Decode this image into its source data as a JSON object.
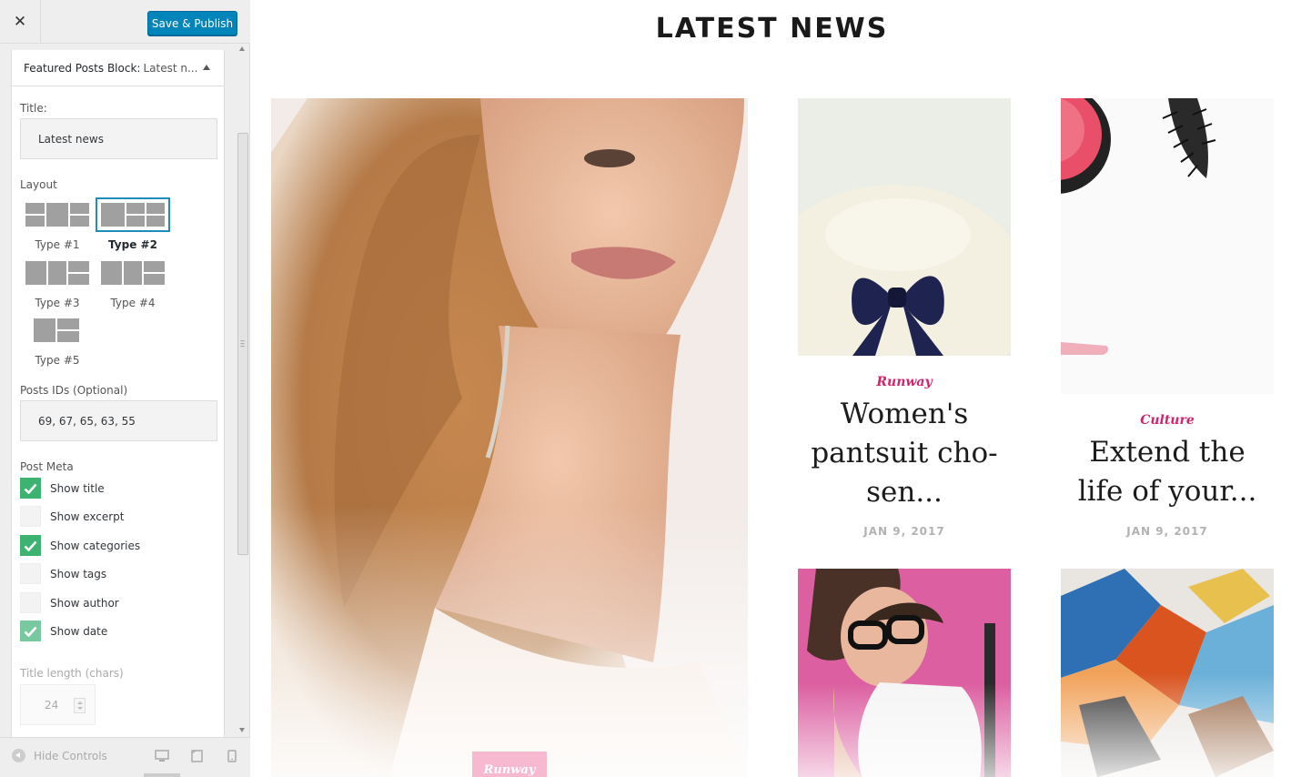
{
  "sidebar": {
    "header": {
      "close_glyph": "✕",
      "publish_label": "Save & Publish"
    },
    "section": {
      "title": "Featured Posts Block:",
      "subtitle": "Latest n..."
    },
    "title_field": {
      "label": "Title:",
      "value": "Latest news"
    },
    "layout": {
      "label": "Layout",
      "selected": "Type #2",
      "options": [
        {
          "label": "Type #1"
        },
        {
          "label": "Type #2"
        },
        {
          "label": "Type #3"
        },
        {
          "label": "Type #4"
        },
        {
          "label": "Type #5"
        }
      ]
    },
    "post_ids": {
      "label": "Posts IDs (Optional)",
      "value": "69, 67, 65, 63, 55"
    },
    "post_meta": {
      "label": "Post Meta",
      "options": [
        {
          "label": "Show title",
          "checked": true
        },
        {
          "label": "Show excerpt",
          "checked": false
        },
        {
          "label": "Show categories",
          "checked": true
        },
        {
          "label": "Show tags",
          "checked": false
        },
        {
          "label": "Show author",
          "checked": false
        },
        {
          "label": "Show date",
          "checked": true
        }
      ]
    },
    "title_length": {
      "label": "Title length (chars)",
      "value": "24"
    },
    "footer": {
      "hide_controls_label": "Hide Controls",
      "devices": [
        "desktop-icon",
        "tablet-icon",
        "mobile-icon"
      ]
    },
    "colors": {
      "publish": "#0085ba",
      "check": "#3cb371",
      "selected_outline": "#1e8cbe"
    }
  },
  "preview": {
    "block_title": "LATEST NEWS",
    "posts": [
      {
        "category": "Runway",
        "title": "Women's pantsuit cho-sen...",
        "title_lines": [
          "Women's",
          "pantsuit cho-",
          "sen..."
        ],
        "date": "JAN 9, 2017"
      },
      {
        "category": "Culture",
        "title": "Extend the life of your...",
        "title_lines": [
          "Extend the",
          "life of your..."
        ],
        "date": "JAN 9, 2017"
      }
    ],
    "hero_category": "Runway",
    "colors": {
      "category": "#d2236b",
      "date": "#b2b2b2"
    }
  }
}
